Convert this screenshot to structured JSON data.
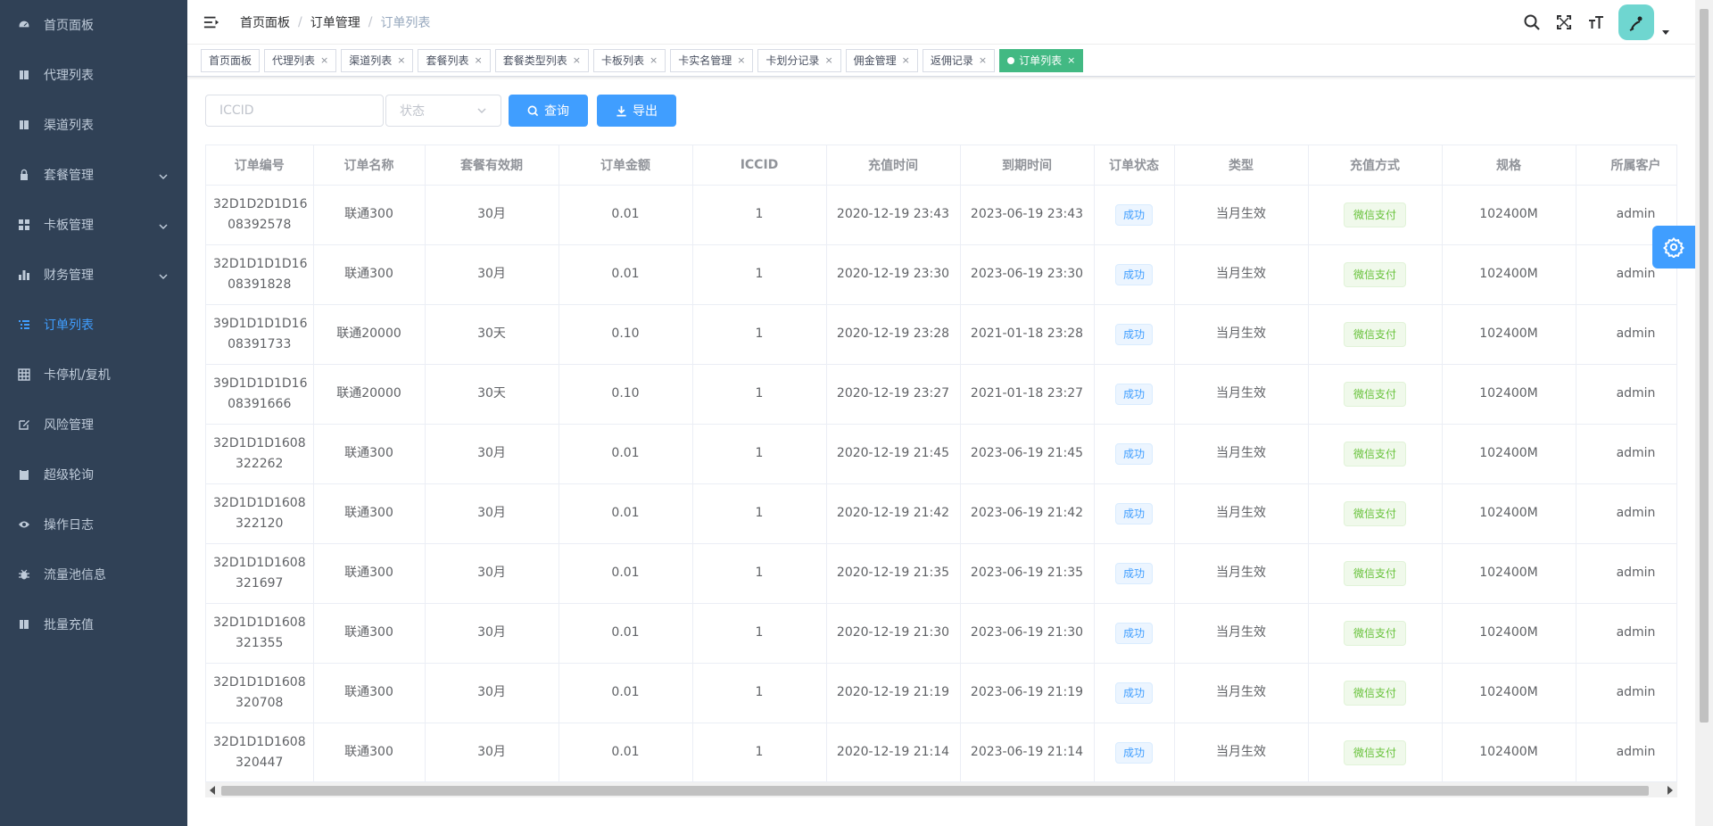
{
  "sidebar": {
    "items": [
      {
        "label": "首页面板",
        "icon": "dashboard-icon",
        "has_arrow": false,
        "active": false
      },
      {
        "label": "代理列表",
        "icon": "book-icon",
        "has_arrow": false,
        "active": false
      },
      {
        "label": "渠道列表",
        "icon": "book-icon",
        "has_arrow": false,
        "active": false
      },
      {
        "label": "套餐管理",
        "icon": "lock-icon",
        "has_arrow": true,
        "active": false
      },
      {
        "label": "卡板管理",
        "icon": "grid-icon",
        "has_arrow": true,
        "active": false
      },
      {
        "label": "财务管理",
        "icon": "bar-chart-icon",
        "has_arrow": true,
        "active": false
      },
      {
        "label": "订单列表",
        "icon": "list-icon",
        "has_arrow": false,
        "active": true
      },
      {
        "label": "卡停机/复机",
        "icon": "table-icon",
        "has_arrow": false,
        "active": false
      },
      {
        "label": "风险管理",
        "icon": "edit-icon",
        "has_arrow": false,
        "active": false
      },
      {
        "label": "超级轮询",
        "icon": "clipboard-icon",
        "has_arrow": false,
        "active": false
      },
      {
        "label": "操作日志",
        "icon": "eye-icon",
        "has_arrow": false,
        "active": false
      },
      {
        "label": "流量池信息",
        "icon": "bug-icon",
        "has_arrow": false,
        "active": false
      },
      {
        "label": "批量充值",
        "icon": "book-icon",
        "has_arrow": false,
        "active": false
      }
    ]
  },
  "breadcrumb": [
    "首页面板",
    "订单管理",
    "订单列表"
  ],
  "tags": [
    {
      "label": "首页面板",
      "closable": false,
      "active": false
    },
    {
      "label": "代理列表",
      "closable": true,
      "active": false
    },
    {
      "label": "渠道列表",
      "closable": true,
      "active": false
    },
    {
      "label": "套餐列表",
      "closable": true,
      "active": false
    },
    {
      "label": "套餐类型列表",
      "closable": true,
      "active": false
    },
    {
      "label": "卡板列表",
      "closable": true,
      "active": false
    },
    {
      "label": "卡实名管理",
      "closable": true,
      "active": false
    },
    {
      "label": "卡划分记录",
      "closable": true,
      "active": false
    },
    {
      "label": "佣金管理",
      "closable": true,
      "active": false
    },
    {
      "label": "返佣记录",
      "closable": true,
      "active": false
    },
    {
      "label": "订单列表",
      "closable": true,
      "active": true
    }
  ],
  "filters": {
    "iccid_placeholder": "ICCID",
    "status_placeholder": "状态",
    "query_label": "查询",
    "export_label": "导出"
  },
  "colors": {
    "sidebar_bg": "#304156",
    "sidebar_text": "#bfcbd9",
    "primary": "#409eff",
    "tag_active": "#42b983",
    "success_text": "#67c23a"
  },
  "table": {
    "columns": [
      "订单编号",
      "订单名称",
      "套餐有效期",
      "订单金额",
      "ICCID",
      "充值时间",
      "到期时间",
      "订单状态",
      "类型",
      "充值方式",
      "规格",
      "所属客户"
    ],
    "rows": [
      {
        "order_no_1": "32D1D2D1D16",
        "order_no_2": "08392578",
        "name": "联通300",
        "validity": "30月",
        "amount": "0.01",
        "iccid": "1",
        "recharge_time": "2020-12-19 23:43",
        "expire_time": "2023-06-19 23:43",
        "status": "成功",
        "type": "当月生效",
        "pay_method": "微信支付",
        "spec": "102400M",
        "customer": "admin"
      },
      {
        "order_no_1": "32D1D1D1D16",
        "order_no_2": "08391828",
        "name": "联通300",
        "validity": "30月",
        "amount": "0.01",
        "iccid": "1",
        "recharge_time": "2020-12-19 23:30",
        "expire_time": "2023-06-19 23:30",
        "status": "成功",
        "type": "当月生效",
        "pay_method": "微信支付",
        "spec": "102400M",
        "customer": "admin"
      },
      {
        "order_no_1": "39D1D1D1D16",
        "order_no_2": "08391733",
        "name": "联通20000",
        "validity": "30天",
        "amount": "0.10",
        "iccid": "1",
        "recharge_time": "2020-12-19 23:28",
        "expire_time": "2021-01-18 23:28",
        "status": "成功",
        "type": "当月生效",
        "pay_method": "微信支付",
        "spec": "102400M",
        "customer": "admin"
      },
      {
        "order_no_1": "39D1D1D1D16",
        "order_no_2": "08391666",
        "name": "联通20000",
        "validity": "30天",
        "amount": "0.10",
        "iccid": "1",
        "recharge_time": "2020-12-19 23:27",
        "expire_time": "2021-01-18 23:27",
        "status": "成功",
        "type": "当月生效",
        "pay_method": "微信支付",
        "spec": "102400M",
        "customer": "admin"
      },
      {
        "order_no_1": "32D1D1D1608",
        "order_no_2": "322262",
        "name": "联通300",
        "validity": "30月",
        "amount": "0.01",
        "iccid": "1",
        "recharge_time": "2020-12-19 21:45",
        "expire_time": "2023-06-19 21:45",
        "status": "成功",
        "type": "当月生效",
        "pay_method": "微信支付",
        "spec": "102400M",
        "customer": "admin"
      },
      {
        "order_no_1": "32D1D1D1608",
        "order_no_2": "322120",
        "name": "联通300",
        "validity": "30月",
        "amount": "0.01",
        "iccid": "1",
        "recharge_time": "2020-12-19 21:42",
        "expire_time": "2023-06-19 21:42",
        "status": "成功",
        "type": "当月生效",
        "pay_method": "微信支付",
        "spec": "102400M",
        "customer": "admin"
      },
      {
        "order_no_1": "32D1D1D1608",
        "order_no_2": "321697",
        "name": "联通300",
        "validity": "30月",
        "amount": "0.01",
        "iccid": "1",
        "recharge_time": "2020-12-19 21:35",
        "expire_time": "2023-06-19 21:35",
        "status": "成功",
        "type": "当月生效",
        "pay_method": "微信支付",
        "spec": "102400M",
        "customer": "admin"
      },
      {
        "order_no_1": "32D1D1D1608",
        "order_no_2": "321355",
        "name": "联通300",
        "validity": "30月",
        "amount": "0.01",
        "iccid": "1",
        "recharge_time": "2020-12-19 21:30",
        "expire_time": "2023-06-19 21:30",
        "status": "成功",
        "type": "当月生效",
        "pay_method": "微信支付",
        "spec": "102400M",
        "customer": "admin"
      },
      {
        "order_no_1": "32D1D1D1608",
        "order_no_2": "320708",
        "name": "联通300",
        "validity": "30月",
        "amount": "0.01",
        "iccid": "1",
        "recharge_time": "2020-12-19 21:19",
        "expire_time": "2023-06-19 21:19",
        "status": "成功",
        "type": "当月生效",
        "pay_method": "微信支付",
        "spec": "102400M",
        "customer": "admin"
      },
      {
        "order_no_1": "32D1D1D1608",
        "order_no_2": "320447",
        "name": "联通300",
        "validity": "30月",
        "amount": "0.01",
        "iccid": "1",
        "recharge_time": "2020-12-19 21:14",
        "expire_time": "2023-06-19 21:14",
        "status": "成功",
        "type": "当月生效",
        "pay_method": "微信支付",
        "spec": "102400M",
        "customer": "admin"
      }
    ]
  }
}
